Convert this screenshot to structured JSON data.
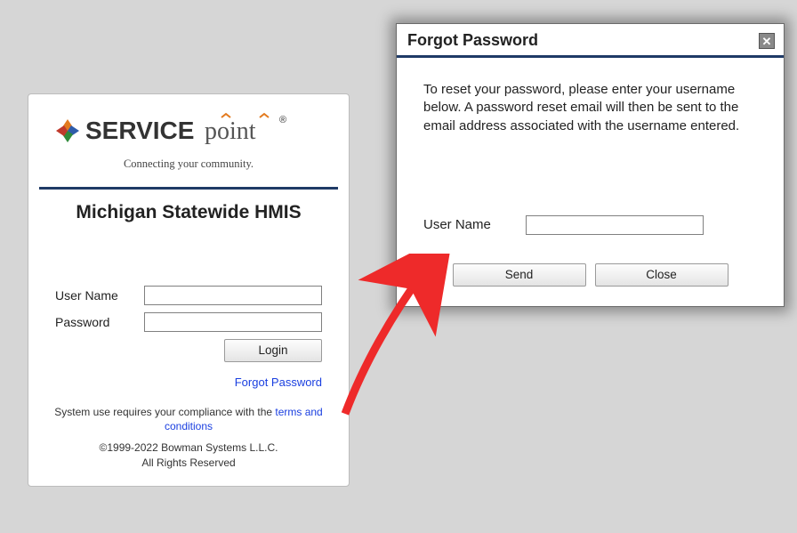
{
  "login": {
    "brand_service": "SERVICE",
    "brand_point": "point",
    "tagline": "Connecting your community.",
    "system_title": "Michigan Statewide HMIS",
    "username_label": "User Name",
    "password_label": "Password",
    "login_button": "Login",
    "forgot_link": "Forgot Password",
    "compliance_prefix": "System use requires your compliance with the ",
    "compliance_link": "terms and conditions",
    "copyright_line1": "©1999-2022 Bowman Systems L.L.C.",
    "copyright_line2": "All Rights Reserved"
  },
  "dialog": {
    "title": "Forgot Password",
    "instructions": "To reset your password, please enter your username below. A password reset email will then be sent to the email address associated with the username entered.",
    "username_label": "User Name",
    "send_button": "Send",
    "close_button": "Close"
  }
}
